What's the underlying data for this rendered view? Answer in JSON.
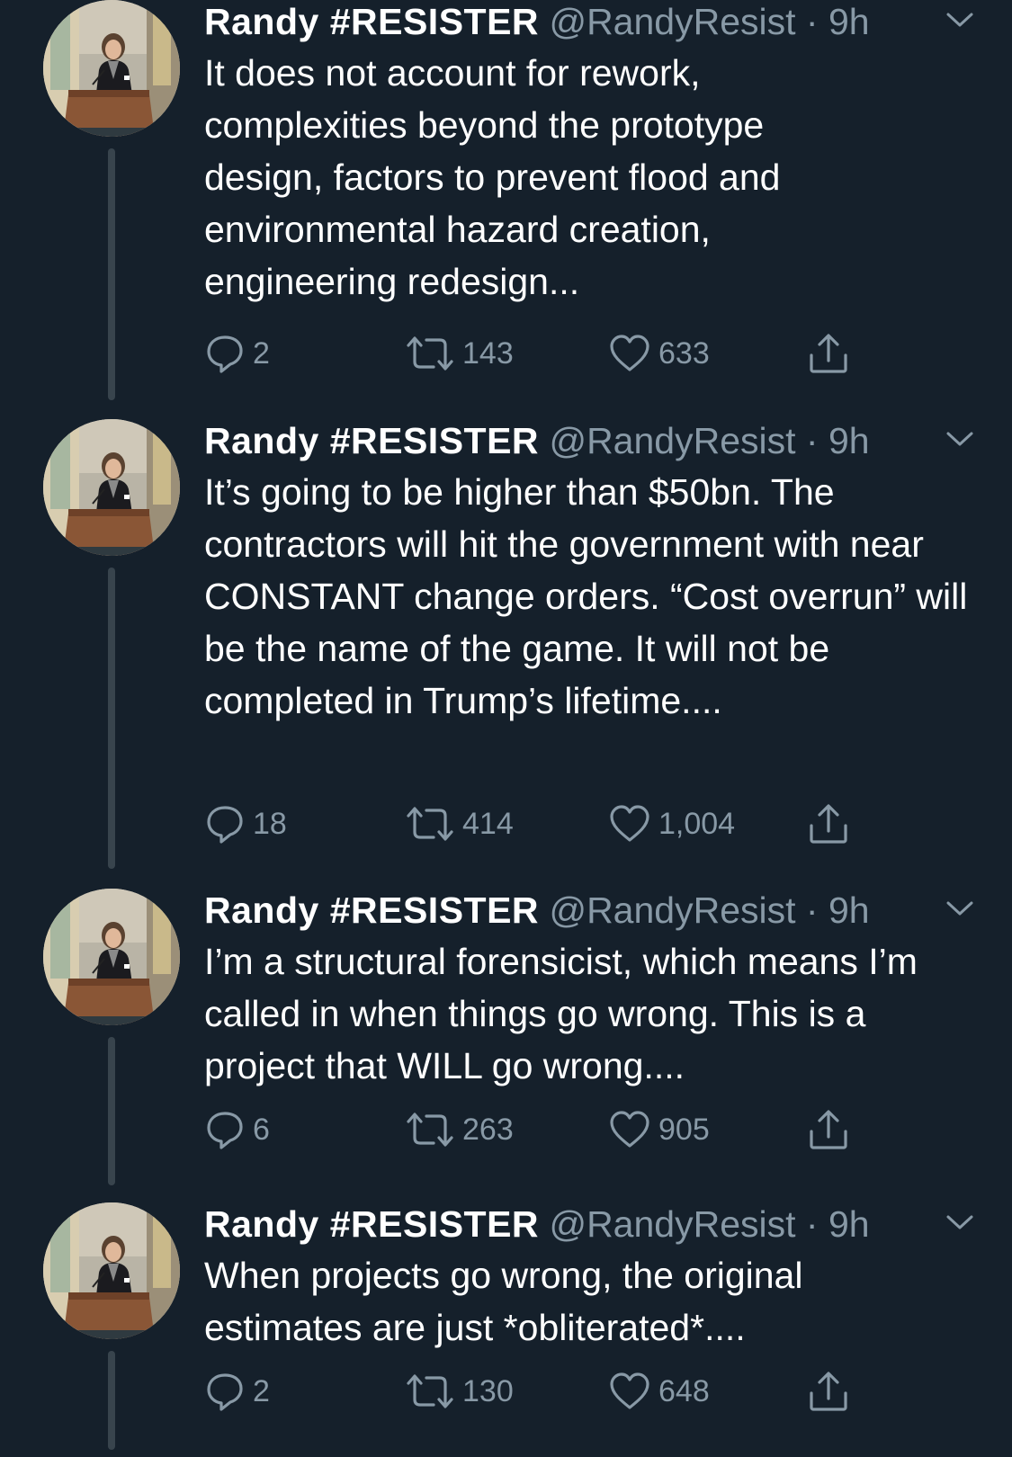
{
  "tweets": [
    {
      "display_name": "Randy #RESISTER",
      "handle": "@RandyResist",
      "separator": "·",
      "time": "9h",
      "text": "It does not account for rework, complexities beyond the prototype design, factors to prevent flood and environmental hazard creation, engineering redesign...",
      "replies": "2",
      "retweets": "143",
      "likes": "633"
    },
    {
      "display_name": "Randy #RESISTER",
      "handle": "@RandyResist",
      "separator": "·",
      "time": "9h",
      "text": "It’s going to be higher than $50bn. The contractors will hit the government with near CONSTANT change orders. “Cost overrun” will be the name of the game. It will not be completed in Trump’s lifetime....",
      "replies": "18",
      "retweets": "414",
      "likes": "1,004"
    },
    {
      "display_name": "Randy #RESISTER",
      "handle": "@RandyResist",
      "separator": "·",
      "time": "9h",
      "text": "I’m a structural forensicist, which means I’m called in when things go wrong. This is a project that WILL go wrong....",
      "replies": "6",
      "retweets": "263",
      "likes": "905"
    },
    {
      "display_name": "Randy #RESISTER",
      "handle": "@RandyResist",
      "separator": "·",
      "time": "9h",
      "text": "When projects go wrong, the original estimates are just *obliterated*....",
      "replies": "2",
      "retweets": "130",
      "likes": "648"
    }
  ],
  "icons": {
    "reply": "reply-icon",
    "retweet": "retweet-icon",
    "like": "like-icon",
    "share": "share-icon",
    "caret": "chevron-down-icon"
  },
  "colors": {
    "background": "#15202b",
    "text": "#ffffff",
    "secondary": "#8899a6",
    "thread_line": "#38444d"
  }
}
